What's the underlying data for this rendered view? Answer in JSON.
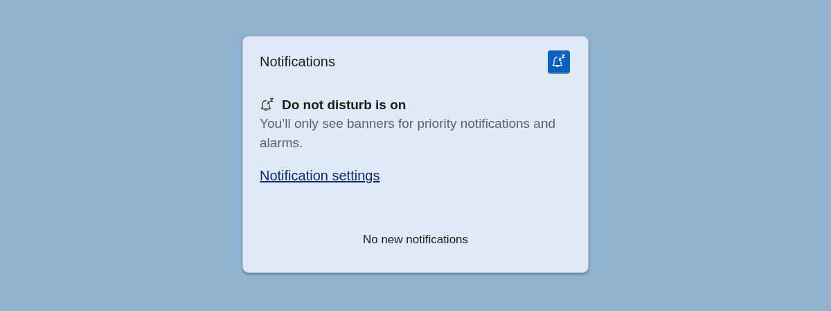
{
  "panel": {
    "title": "Notifications",
    "dnd_toggle": {
      "on": true
    }
  },
  "dnd_status": {
    "heading": "Do not disturb is on",
    "description": "You’ll only see banners for priority notifications and alarms."
  },
  "settings_link": "Notification settings",
  "empty_message": "No new notifications"
}
